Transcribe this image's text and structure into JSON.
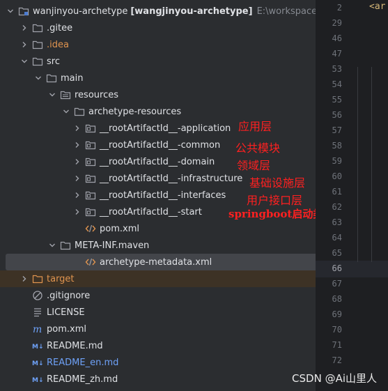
{
  "project_tree": {
    "root": {
      "name": "wanjinyou-archetype",
      "module": "[wangjinyou-archetype]",
      "path": "E:\\workspace\\idea"
    },
    "items": [
      {
        "name": ".gitee"
      },
      {
        "name": ".idea"
      },
      {
        "name": "src"
      },
      {
        "name": "main"
      },
      {
        "name": "resources"
      },
      {
        "name": "archetype-resources"
      },
      {
        "name": "__rootArtifactId__-application"
      },
      {
        "name": "__rootArtifactId__-common"
      },
      {
        "name": "__rootArtifactId__-domain"
      },
      {
        "name": "__rootArtifactId__-infrastructure"
      },
      {
        "name": "__rootArtifactId__-interfaces"
      },
      {
        "name": "__rootArtifactId__-start"
      },
      {
        "name": "pom.xml"
      },
      {
        "name": "META-INF.maven"
      },
      {
        "name": "archetype-metadata.xml"
      },
      {
        "name": "target"
      },
      {
        "name": ".gitignore"
      },
      {
        "name": "LICENSE"
      },
      {
        "name": "pom.xml"
      },
      {
        "name": "README.md"
      },
      {
        "name": "README_en.md"
      },
      {
        "name": "README_zh.md"
      }
    ]
  },
  "annotations": [
    "应用层",
    "公共模块",
    "领域层",
    "基础设施层",
    "用户接口层",
    "springboot启动类"
  ],
  "editor": {
    "line_numbers": [
      "2",
      "29",
      "46",
      "47",
      "53",
      "54",
      "55",
      "56",
      "57",
      "58",
      "59",
      "60",
      "61",
      "62",
      "63",
      "64",
      "65",
      "66",
      "67",
      "68",
      "69",
      "70",
      "71",
      "72"
    ],
    "current_line": "66",
    "code_fragment": "<ar"
  },
  "watermark": "CSDN @Ai山里人",
  "colors": {
    "accent_orange": "#e0944f",
    "git_blue": "#6ea1f7",
    "annotation_red": "#ff2020",
    "panel_bg": "#2b2d30",
    "editor_bg": "#1e1f22"
  }
}
